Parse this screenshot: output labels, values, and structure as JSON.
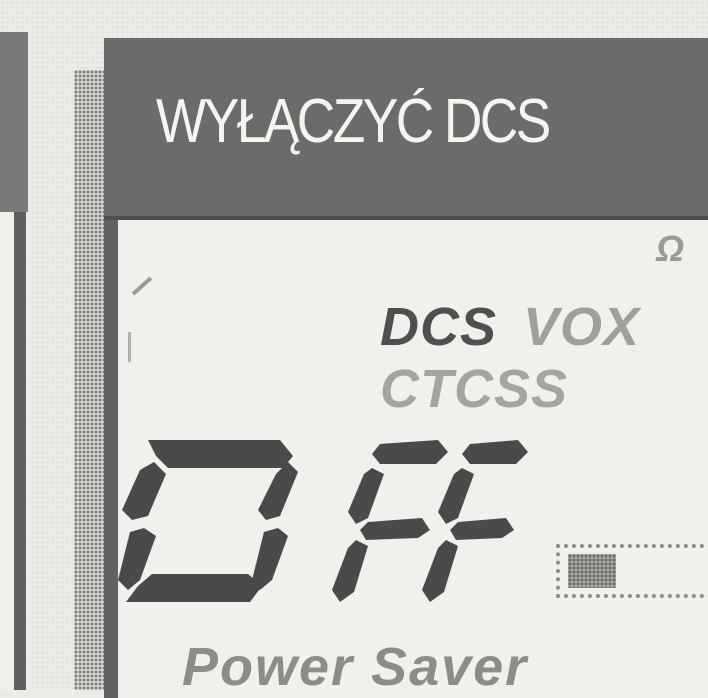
{
  "title": "WYŁĄCZYĆ DCS",
  "display": {
    "top_fragment": "Ω",
    "indicators": {
      "dcs": "DCS",
      "vox": "VOX",
      "ctcss": "CTCSS"
    },
    "segment_readout": "OFF",
    "battery_level": 0.3,
    "footer_label": "Power Saver"
  },
  "colors": {
    "title_bar": "#6b6b69",
    "title_text": "#f4f4f1",
    "segment": "#4a4a48",
    "active_indicator": "#4f4f4d",
    "inactive_indicator": "#9f9f9c"
  },
  "icons": [
    "battery-icon"
  ]
}
